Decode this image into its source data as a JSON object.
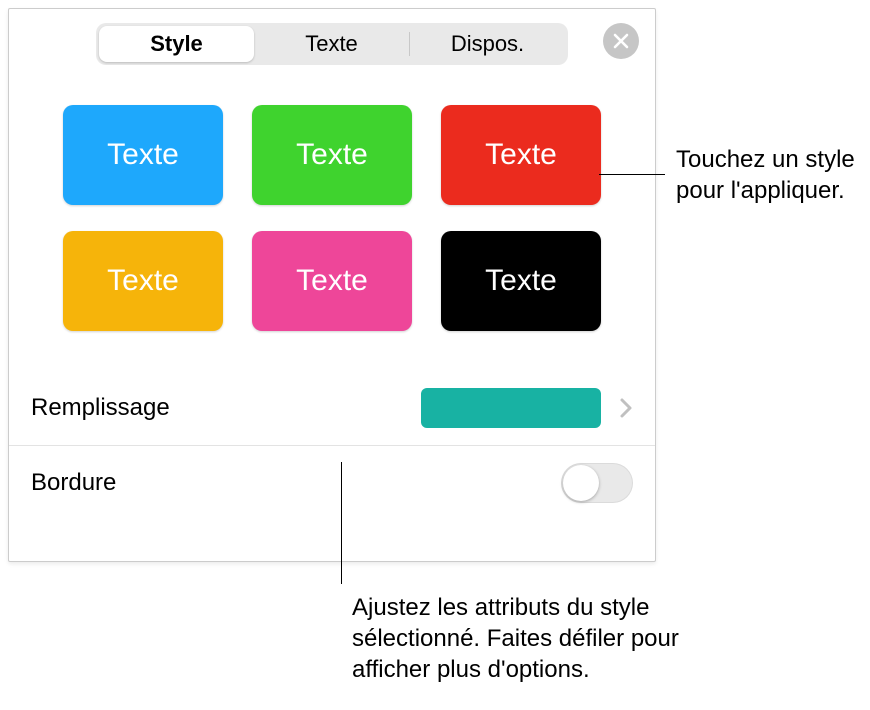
{
  "tabs": {
    "style": "Style",
    "texte": "Texte",
    "dispos": "Dispos."
  },
  "swatches": [
    {
      "label": "Texte",
      "bg": "#1EA8FC"
    },
    {
      "label": "Texte",
      "bg": "#3FD32E"
    },
    {
      "label": "Texte",
      "bg": "#EB2B1E"
    },
    {
      "label": "Texte",
      "bg": "#F6B40A"
    },
    {
      "label": "Texte",
      "bg": "#EE4699"
    },
    {
      "label": "Texte",
      "bg": "#000000"
    }
  ],
  "rows": {
    "fill_label": "Remplissage",
    "fill_color": "#18B2A3",
    "border_label": "Bordure"
  },
  "callouts": {
    "apply": "Touchez un style pour l'appliquer.",
    "adjust": "Ajustez les attributs du style sélectionné. Faites défiler pour afficher plus d'options."
  }
}
